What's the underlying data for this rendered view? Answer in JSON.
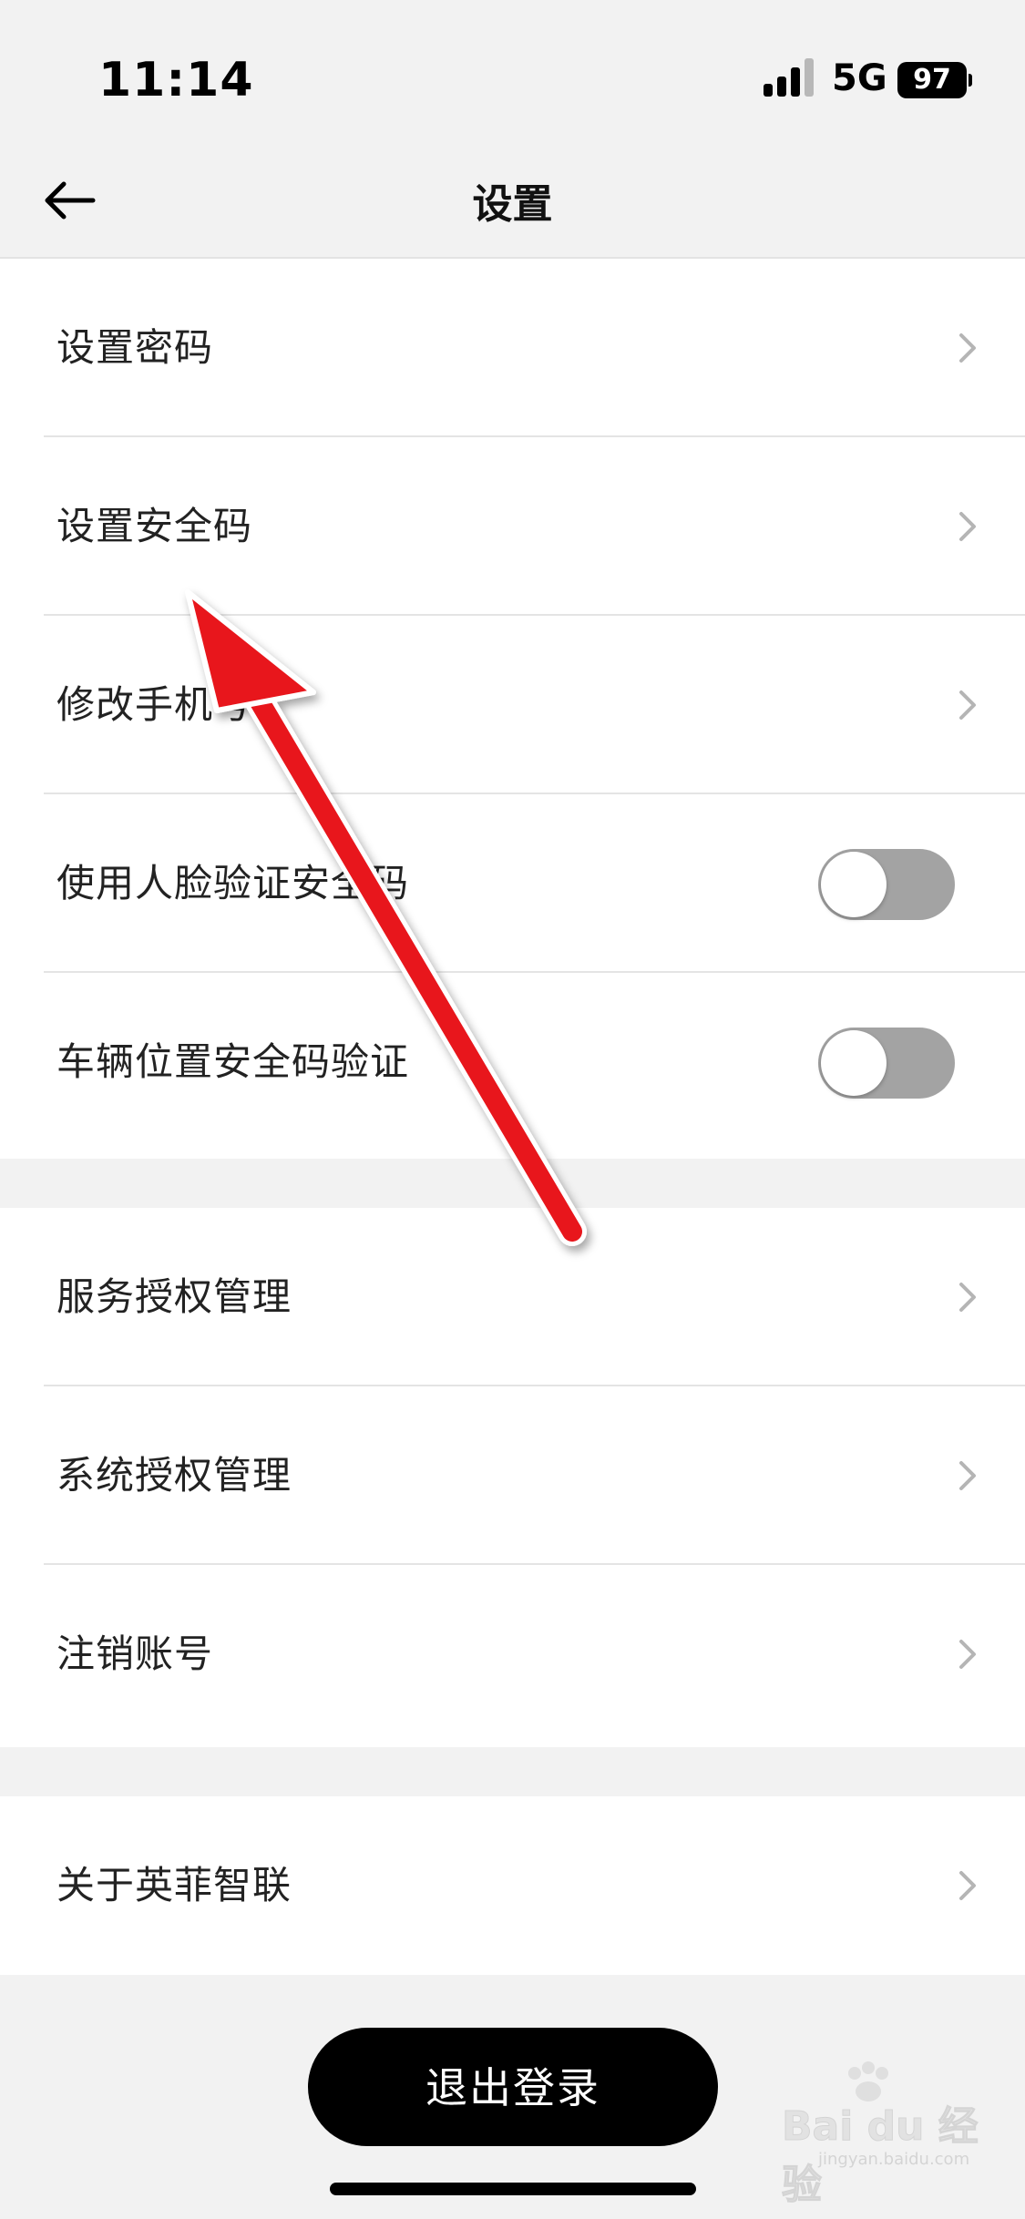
{
  "status_bar": {
    "time": "11:14",
    "network": "5G",
    "battery": "97"
  },
  "nav": {
    "title": "设置",
    "back_icon": "arrow-left-icon"
  },
  "groups": [
    {
      "rows": [
        {
          "label": "设置密码",
          "control": "chevron"
        },
        {
          "label": "设置安全码",
          "control": "chevron"
        },
        {
          "label": "修改手机号",
          "control": "chevron"
        },
        {
          "label": "使用人脸验证安全码",
          "control": "toggle",
          "on": false
        },
        {
          "label": "车辆位置安全码验证",
          "control": "toggle",
          "on": false
        }
      ]
    },
    {
      "rows": [
        {
          "label": "服务授权管理",
          "control": "chevron"
        },
        {
          "label": "系统授权管理",
          "control": "chevron"
        },
        {
          "label": "注销账号",
          "control": "chevron"
        }
      ]
    },
    {
      "rows": [
        {
          "label": "关于英菲智联",
          "control": "chevron"
        }
      ]
    }
  ],
  "logout_label": "退出登录",
  "annotation": {
    "type": "arrow",
    "color": "#e8141a"
  },
  "watermark": {
    "text": "Bai du 经验",
    "sub": "jingyan.baidu.com"
  },
  "colors": {
    "background": "#f2f2f2",
    "toggle_off": "#a3a3a3",
    "button": "#000000"
  }
}
